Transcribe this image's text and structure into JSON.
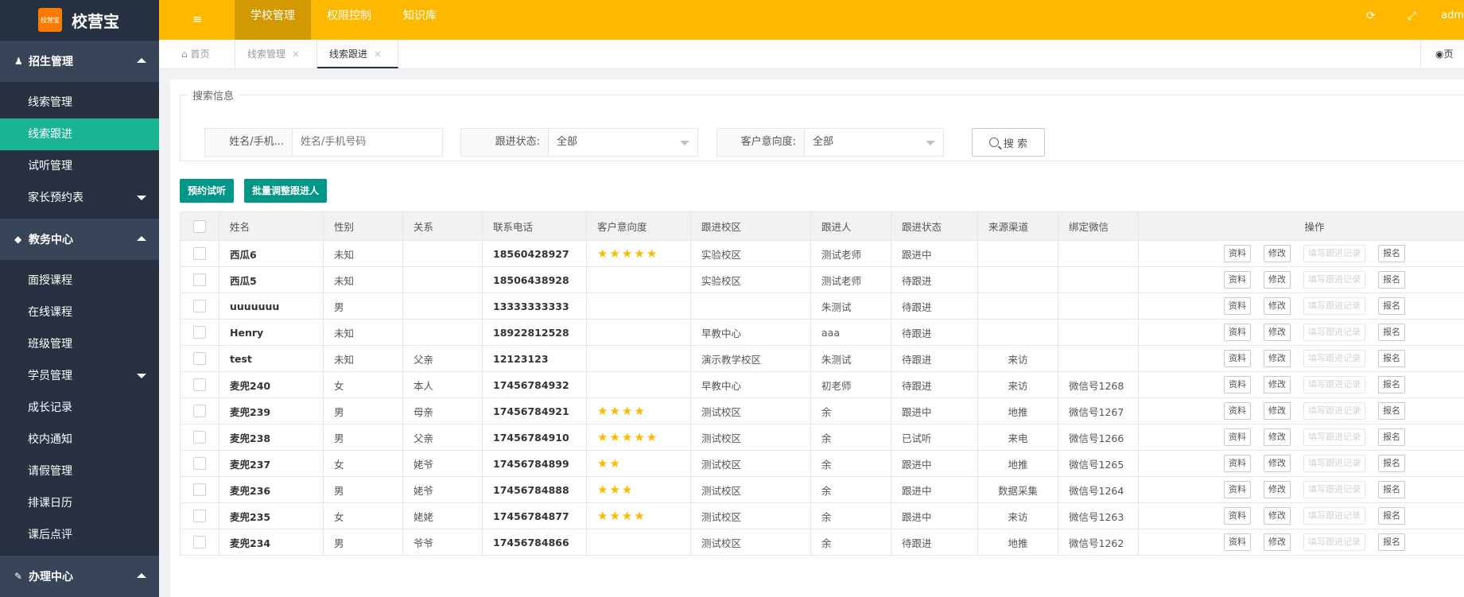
{
  "app": {
    "logo_badge": "校营宝",
    "name": "校营宝"
  },
  "topbar": {
    "tabs": [
      {
        "label": "学校管理",
        "active": true
      },
      {
        "label": "权限控制",
        "active": false
      },
      {
        "label": "知识库",
        "active": false
      }
    ],
    "user": "adm"
  },
  "sidebar": {
    "groups": [
      {
        "label": "招生管理",
        "icon": "user-icon",
        "items": [
          "线索管理",
          "线索跟进",
          "试听管理",
          "家长预约表"
        ]
      },
      {
        "label": "教务中心",
        "icon": "graduation-cap-icon",
        "items": [
          "面授课程",
          "在线课程",
          "班级管理",
          "学员管理",
          "成长记录",
          "校内通知",
          "请假管理",
          "排课日历",
          "课后点评"
        ]
      },
      {
        "label": "办理中心",
        "icon": "edit-icon",
        "items": []
      }
    ],
    "active_item": "线索跟进"
  },
  "pagetabs": [
    {
      "label": "首页"
    },
    {
      "label": "线索管理"
    },
    {
      "label": "线索跟进"
    }
  ],
  "pagetabs_right": "页",
  "search": {
    "legend": "搜索信息",
    "name_label": "姓名/手机...",
    "name_placeholder": "姓名/手机号码",
    "status_label": "跟进状态:",
    "status_value": "全部",
    "intent_label": "客户意向度:",
    "intent_value": "全部",
    "button": "搜 索"
  },
  "actions": {
    "book_trial": "预约试听",
    "batch_adjust": "批量调整跟进人"
  },
  "table": {
    "headers": [
      "姓名",
      "性别",
      "关系",
      "联系电话",
      "客户意向度",
      "跟进校区",
      "跟进人",
      "跟进状态",
      "来源渠道",
      "绑定微信",
      "操作"
    ],
    "op_buttons": [
      "资料",
      "修改",
      "填写跟进记录",
      "报名"
    ],
    "rows": [
      {
        "name": "西瓜6",
        "gender": "未知",
        "relation": "",
        "phone": "18560428927",
        "stars": 5,
        "campus": "实验校区",
        "follower": "测试老师",
        "status": "跟进中",
        "source": "",
        "wechat": ""
      },
      {
        "name": "西瓜5",
        "gender": "未知",
        "relation": "",
        "phone": "18506438928",
        "stars": 0,
        "campus": "实验校区",
        "follower": "测试老师",
        "status": "待跟进",
        "source": "",
        "wechat": ""
      },
      {
        "name": "uuuuuuu",
        "gender": "男",
        "relation": "",
        "phone": "13333333333",
        "stars": 0,
        "campus": "",
        "follower": "朱测试",
        "status": "待跟进",
        "source": "",
        "wechat": ""
      },
      {
        "name": "Henry",
        "gender": "未知",
        "relation": "",
        "phone": "18922812528",
        "stars": 0,
        "campus": "早教中心",
        "follower": "aaa",
        "status": "待跟进",
        "source": "",
        "wechat": ""
      },
      {
        "name": "test",
        "gender": "未知",
        "relation": "父亲",
        "phone": "12123123",
        "stars": 0,
        "campus": "演示教学校区",
        "follower": "朱测试",
        "status": "待跟进",
        "source": "来访",
        "wechat": ""
      },
      {
        "name": "麦兜240",
        "gender": "女",
        "relation": "本人",
        "phone": "17456784932",
        "stars": 0,
        "campus": "早教中心",
        "follower": "初老师",
        "status": "待跟进",
        "source": "来访",
        "wechat": "微信号1268"
      },
      {
        "name": "麦兜239",
        "gender": "男",
        "relation": "母亲",
        "phone": "17456784921",
        "stars": 4,
        "campus": "测试校区",
        "follower": "余",
        "status": "跟进中",
        "source": "地推",
        "wechat": "微信号1267"
      },
      {
        "name": "麦兜238",
        "gender": "男",
        "relation": "父亲",
        "phone": "17456784910",
        "stars": 5,
        "campus": "测试校区",
        "follower": "余",
        "status": "已试听",
        "source": "来电",
        "wechat": "微信号1266"
      },
      {
        "name": "麦兜237",
        "gender": "女",
        "relation": "姥爷",
        "phone": "17456784899",
        "stars": 2,
        "campus": "测试校区",
        "follower": "余",
        "status": "跟进中",
        "source": "地推",
        "wechat": "微信号1265"
      },
      {
        "name": "麦兜236",
        "gender": "男",
        "relation": "姥爷",
        "phone": "17456784888",
        "stars": 3,
        "campus": "测试校区",
        "follower": "余",
        "status": "跟进中",
        "source": "数据采集",
        "wechat": "微信号1264"
      },
      {
        "name": "麦兜235",
        "gender": "女",
        "relation": "姥姥",
        "phone": "17456784877",
        "stars": 4,
        "campus": "测试校区",
        "follower": "余",
        "status": "跟进中",
        "source": "来访",
        "wechat": "微信号1263"
      },
      {
        "name": "麦兜234",
        "gender": "男",
        "relation": "爷爷",
        "phone": "17456784866",
        "stars": 0,
        "campus": "测试校区",
        "follower": "余",
        "status": "待跟进",
        "source": "地推",
        "wechat": "微信号1262"
      }
    ]
  },
  "colors": {
    "topbar": "#ffb800",
    "sidebar": "#273142",
    "active": "#1ab394",
    "primary_btn": "#009688"
  }
}
